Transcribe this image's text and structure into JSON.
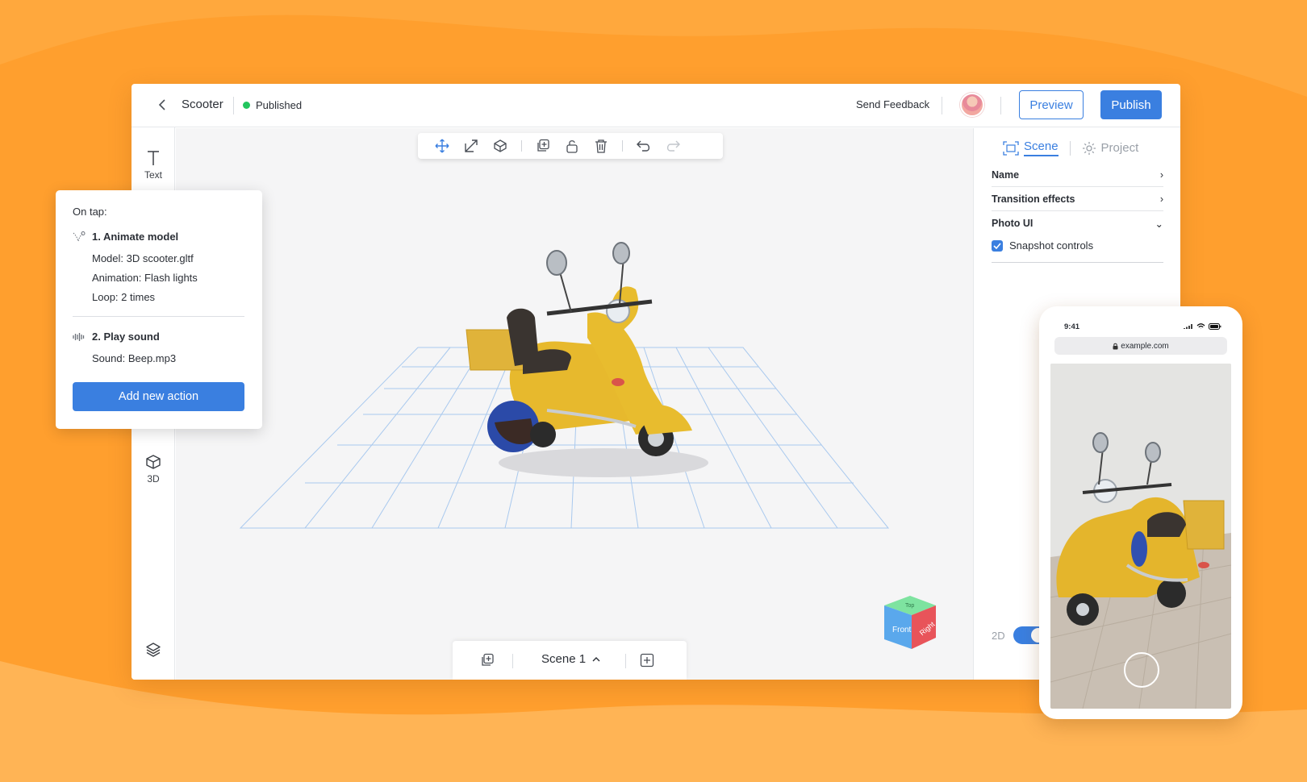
{
  "header": {
    "back_icon": "chevron-left-icon",
    "project_name": "Scooter",
    "status": "Published",
    "status_color": "#22c55e",
    "feedback": "Send Feedback",
    "preview": "Preview",
    "publish": "Publish"
  },
  "left_rail": {
    "items": [
      {
        "label": "Text",
        "icon": "text-icon"
      },
      {
        "label": "3D",
        "icon": "cube-icon"
      }
    ],
    "layers_icon": "layers-icon"
  },
  "toolbar": {
    "tools": [
      "move-icon",
      "scale-icon",
      "rotate-icon",
      "duplicate-icon",
      "unlock-icon",
      "delete-icon",
      "undo-icon",
      "redo-icon"
    ]
  },
  "scene_bar": {
    "scene_label": "Scene 1"
  },
  "view_cube": {
    "front": "Front",
    "right": "Right",
    "top": "Top"
  },
  "right_panel": {
    "tabs": [
      {
        "label": "Scene",
        "active": true
      },
      {
        "label": "Project",
        "active": false
      }
    ],
    "rows": [
      {
        "label": "Name",
        "chevron": "›"
      },
      {
        "label": "Transition effects",
        "chevron": "›"
      },
      {
        "label": "Photo UI",
        "chevron": "⌄"
      }
    ],
    "checkbox_label": "Snapshot controls",
    "checkbox_checked": true,
    "toggle_label": "2D"
  },
  "popup": {
    "header": "On tap:",
    "action1_title": "1. Animate model",
    "action1_details": [
      "Model: 3D scooter.gltf",
      "Animation: Flash lights",
      "Loop: 2 times"
    ],
    "action2_title": "2. Play sound",
    "action2_details": [
      "Sound: Beep.mp3"
    ],
    "add_button": "Add new action"
  },
  "phone": {
    "time": "9:41",
    "url": "example.com"
  },
  "colors": {
    "accent": "#3a7fe0",
    "background": "#ff9f2e"
  }
}
